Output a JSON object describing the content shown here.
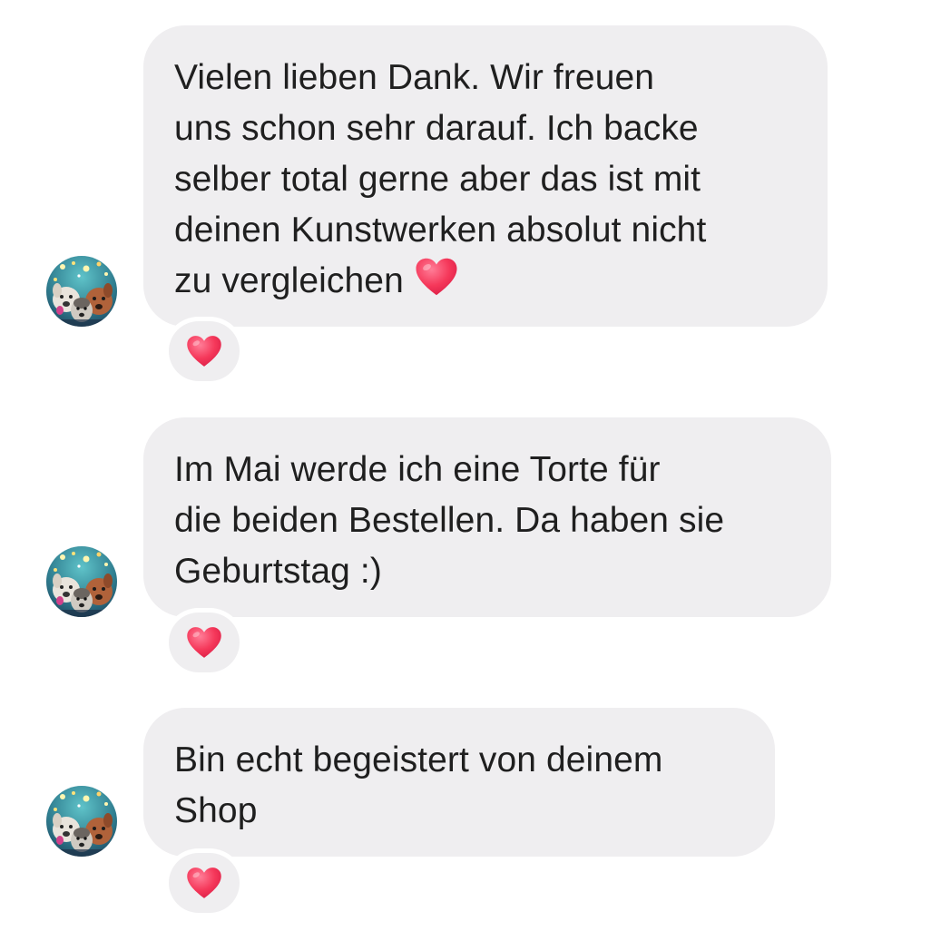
{
  "messages": [
    {
      "lines": [
        "Vielen lieben Dank. Wir freuen",
        "uns schon sehr darauf. Ich backe",
        "selber total gerne aber das ist mit",
        "deinen Kunstwerken absolut nicht",
        "zu vergleichen"
      ],
      "inline_emoji": "heart-emoji",
      "reaction": "heart-emoji"
    },
    {
      "lines": [
        "Im Mai werde ich eine Torte für",
        "die beiden Bestellen. Da haben sie",
        "Geburtstag :)"
      ],
      "reaction": "heart-emoji"
    },
    {
      "lines": [
        "Bin echt begeistert von deinem",
        "Shop"
      ],
      "reaction": "heart-emoji"
    }
  ],
  "avatar_icon": "dogs-group-avatar-icon",
  "colors": {
    "bubble": "#efeef0",
    "text": "#1f1f1f",
    "heart": "#f5385a"
  }
}
